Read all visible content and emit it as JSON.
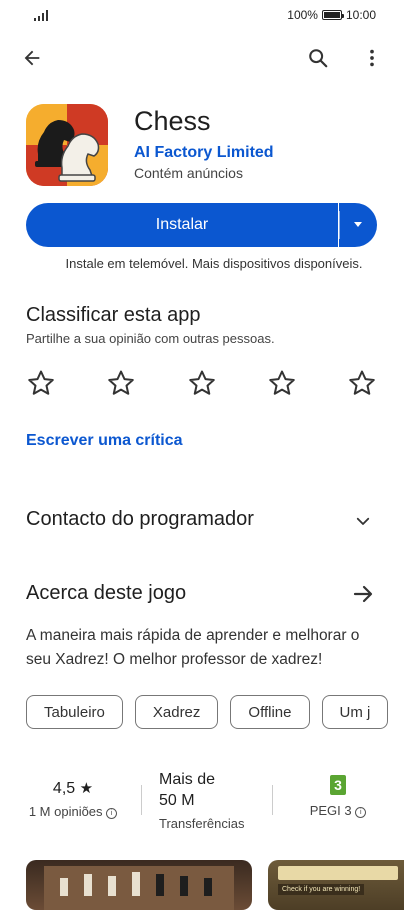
{
  "status_bar": {
    "battery_percent": "100%",
    "time": "10:00",
    "battery_level": 1.0
  },
  "app": {
    "title": "Chess",
    "developer": "AI Factory Limited",
    "ads_note": "Contém anúncios"
  },
  "install": {
    "label": "Instalar",
    "note": "Instale em telemóvel. Mais dispositivos disponíveis."
  },
  "rate": {
    "title": "Classificar esta app",
    "subtitle": "Partilhe a sua opinião com outras pessoas.",
    "write_review": "Escrever uma crítica",
    "stars": 5
  },
  "contact": {
    "title": "Contacto do programador"
  },
  "about": {
    "title": "Acerca deste jogo",
    "description": "A maneira mais rápida de aprender e melhorar o seu Xadrez! O melhor professor de xadrez!"
  },
  "tags": [
    "Tabuleiro",
    "Xadrez",
    "Offline",
    "Um j"
  ],
  "stats": {
    "rating": {
      "value": "4,5",
      "reviews": "1 M opiniões"
    },
    "downloads": {
      "value": "Mais de 50 M",
      "label": "Transferências"
    },
    "pegi": {
      "badge": "3",
      "label": "PEGI 3"
    }
  },
  "screenshot_text": "Check if you are winning!",
  "colors": {
    "accent": "#0b57d0",
    "pegi_green": "#5aa532"
  },
  "icons": [
    "signal-icon",
    "battery-icon",
    "back-arrow-icon",
    "search-icon",
    "more-vert-icon",
    "chevron-down-icon",
    "arrow-right-icon",
    "star-outline-icon",
    "info-icon"
  ]
}
